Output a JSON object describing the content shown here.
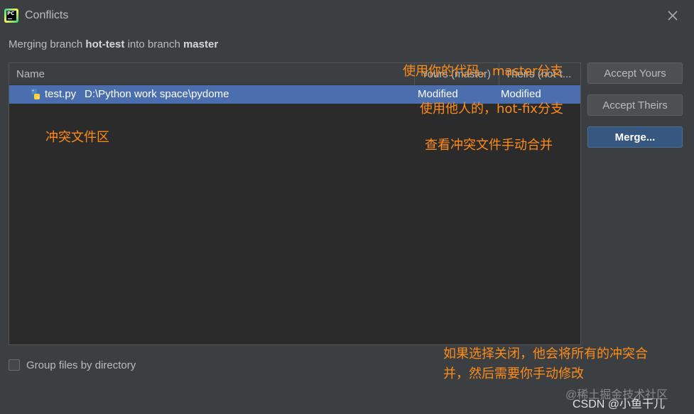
{
  "window": {
    "title": "Conflicts",
    "app_icon_text": "PC"
  },
  "header": {
    "prefix": "Merging branch ",
    "source_branch": "hot-test",
    "middle": " into branch ",
    "target_branch": "master"
  },
  "table": {
    "columns": [
      "Name",
      "Yours (master)",
      "Theirs (hot-t..."
    ],
    "rows": [
      {
        "file": "test.py",
        "path": "D:\\Python work space\\pydome",
        "yours": "Modified",
        "theirs": "Modified"
      }
    ]
  },
  "buttons": {
    "accept_yours": "Accept Yours",
    "accept_theirs": "Accept Theirs",
    "merge": "Merge..."
  },
  "options": {
    "group_by_directory": "Group files by directory"
  },
  "annotations": {
    "use_yours": "使用你的代码，master分支",
    "use_theirs": "使用他人的，hot-fix分支",
    "conflict_area": "冲突文件区",
    "manual_merge": "查看冲突文件手动合并",
    "close_note_line1": "如果选择关闭，他会将所有的冲突合",
    "close_note_line2": "并，然后需要你手动修改"
  },
  "watermarks": {
    "site": "@稀土掘金技术社区",
    "author": "CSDN @小鱼干儿"
  },
  "colors": {
    "background": "#3c3f41",
    "selection": "#4b6eaf",
    "primary_button": "#365880",
    "annotation": "#ff8c1a"
  }
}
